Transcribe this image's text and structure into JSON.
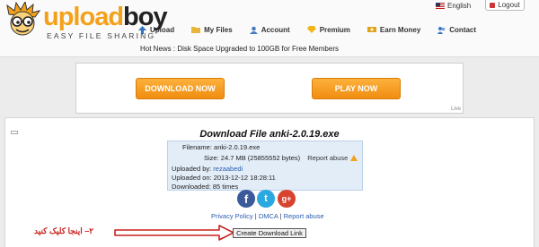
{
  "header": {
    "logo_up": "upload",
    "logo_boy": "boy",
    "tagline": "EASY FILE SHARING",
    "language": "English",
    "logout": "Logout",
    "hot_news": "Hot News : Disk Space Upgraded to 100GB for Free Members",
    "nav": [
      {
        "label": "Upload",
        "icon": "upload-arrow-icon"
      },
      {
        "label": "My Files",
        "icon": "folder-icon"
      },
      {
        "label": "Account",
        "icon": "user-icon"
      },
      {
        "label": "Premium",
        "icon": "diamond-icon"
      },
      {
        "label": "Earn Money",
        "icon": "money-icon"
      },
      {
        "label": "Contact",
        "icon": "contact-icon"
      }
    ]
  },
  "banner": {
    "download_now": "DOWNLOAD NOW",
    "play_now": "PLAY NOW",
    "live": "Live"
  },
  "download": {
    "title": "Download File anki-2.0.19.exe",
    "filename_label": "Filename:",
    "filename": "anki-2.0.19.exe",
    "size_label": "Size:",
    "size": "24.7 MB (25855552 bytes)",
    "report_abuse": "Report abuse",
    "uploaded_by_label": "Uploaded by:",
    "uploaded_by": "rezaabedi",
    "uploaded_on_label": "Uploaded on:",
    "uploaded_on": "2013-12-12 18:28:11",
    "downloaded_label": "Downloaded:",
    "downloaded": "85 times",
    "social": {
      "facebook": "f",
      "twitter": "t",
      "google_plus": "g+"
    },
    "links": {
      "privacy": "Privacy Policy",
      "dmca": "DMCA",
      "report": "Report abuse"
    },
    "create_link": "Create Download Link",
    "annotation": "۲– اینجا کلیک کنید"
  },
  "colors": {
    "orange": "#f4a11a",
    "link": "#2a5db0",
    "annotation": "#c8201b"
  }
}
